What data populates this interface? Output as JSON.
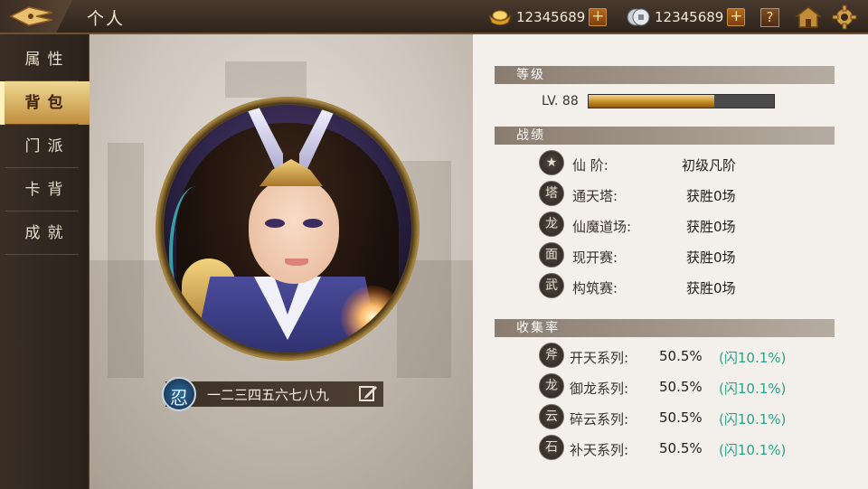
{
  "header": {
    "title": "个人",
    "gold_amount": "12345689",
    "silver_amount": "12345689",
    "help_label": "?"
  },
  "sidebar": {
    "items": [
      {
        "label": "属性"
      },
      {
        "label": "背包",
        "active": true
      },
      {
        "label": "门派"
      },
      {
        "label": "卡背"
      },
      {
        "label": "成就"
      }
    ]
  },
  "profile": {
    "player_name": "一二三四五六七八九",
    "emblem_glyph": "忍"
  },
  "level": {
    "section_title": "等级",
    "label": "LV. 88",
    "exp_fraction": 0.68
  },
  "records": {
    "section_title": "战绩",
    "rows": [
      {
        "icon": "star-icon",
        "glyph": "★",
        "label": "仙  阶:",
        "value": "初级凡阶"
      },
      {
        "icon": "tower-icon",
        "glyph": "塔",
        "label": "通天塔:",
        "value": "获胜0场"
      },
      {
        "icon": "dragon-icon",
        "glyph": "龙",
        "label": "仙魔道场:",
        "value": "获胜0场"
      },
      {
        "icon": "mask-icon",
        "glyph": "面",
        "label": "现开赛:",
        "value": "获胜0场"
      },
      {
        "icon": "fighter-icon",
        "glyph": "武",
        "label": "构筑赛:",
        "value": "获胜0场"
      }
    ]
  },
  "collection": {
    "section_title": "收集率",
    "rows": [
      {
        "icon": "axe-icon",
        "glyph": "斧",
        "label": "开天系列:",
        "value": "50.5%",
        "flash": "(闪10.1%)"
      },
      {
        "icon": "dragon-swirl-icon",
        "glyph": "龙",
        "label": "御龙系列:",
        "value": "50.5%",
        "flash": "(闪10.1%)"
      },
      {
        "icon": "cloud-icon",
        "glyph": "云",
        "label": "碎云系列:",
        "value": "50.5%",
        "flash": "(闪10.1%)"
      },
      {
        "icon": "stone-icon",
        "glyph": "石",
        "label": "补天系列:",
        "value": "50.5%",
        "flash": "(闪10.1%)"
      }
    ]
  },
  "colors": {
    "accent_gold": "#c08c3c",
    "flash_teal": "#2aa28a"
  }
}
